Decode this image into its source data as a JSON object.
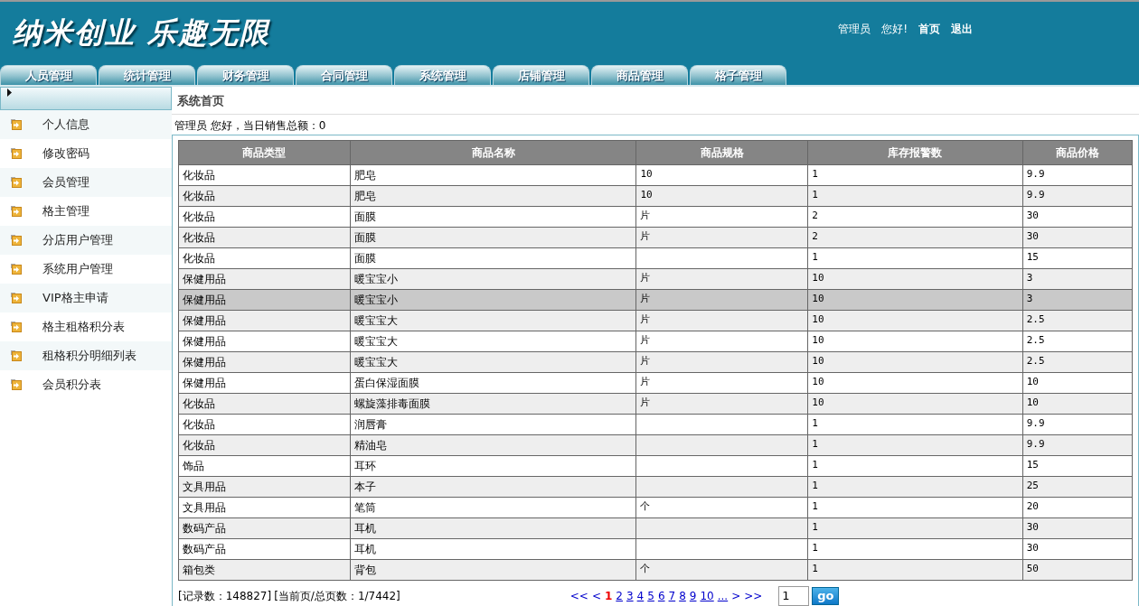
{
  "header": {
    "logo": "纳米创业 乐趣无限",
    "user": "管理员",
    "greeting": "您好!",
    "links": [
      "首页",
      "退出"
    ]
  },
  "tabs": [
    {
      "label": "人员管理",
      "selected": false
    },
    {
      "label": "统计管理",
      "selected": false
    },
    {
      "label": "财务管理",
      "selected": false
    },
    {
      "label": "合同管理",
      "selected": false
    },
    {
      "label": "系统管理",
      "selected": false
    },
    {
      "label": "店铺管理",
      "selected": false
    },
    {
      "label": "商品管理",
      "selected": false
    },
    {
      "label": "格子管理",
      "selected": false
    }
  ],
  "sidebar": {
    "items": [
      "个人信息",
      "修改密码",
      "会员管理",
      "格主管理",
      "分店用户管理",
      "系统用户管理",
      "VIP格主申请",
      "格主租格积分表",
      "租格积分明细列表",
      "会员积分表"
    ]
  },
  "page_title": "系统首页",
  "summary": "管理员 您好，当日销售总额：0",
  "table": {
    "columns": [
      "商品类型",
      "商品名称",
      "商品规格",
      "库存报警数",
      "商品价格"
    ],
    "rows": [
      {
        "cells": [
          "化妆品",
          "肥皂",
          "10",
          "1",
          "9.9"
        ],
        "selected": false
      },
      {
        "cells": [
          "化妆品",
          "肥皂",
          "10",
          "1",
          "9.9"
        ],
        "selected": false
      },
      {
        "cells": [
          "化妆品",
          "面膜",
          "片",
          "2",
          "30"
        ],
        "selected": false
      },
      {
        "cells": [
          "化妆品",
          "面膜",
          "片",
          "2",
          "30"
        ],
        "selected": false
      },
      {
        "cells": [
          "化妆品",
          "面膜",
          "",
          "1",
          "15"
        ],
        "selected": false
      },
      {
        "cells": [
          "保健用品",
          "暖宝宝小",
          "片",
          "10",
          "3"
        ],
        "selected": false
      },
      {
        "cells": [
          "保健用品",
          "暖宝宝小",
          "片",
          "10",
          "3"
        ],
        "selected": true
      },
      {
        "cells": [
          "保健用品",
          "暖宝宝大",
          "片",
          "10",
          "2.5"
        ],
        "selected": false
      },
      {
        "cells": [
          "保健用品",
          "暖宝宝大",
          "片",
          "10",
          "2.5"
        ],
        "selected": false
      },
      {
        "cells": [
          "保健用品",
          "暖宝宝大",
          "片",
          "10",
          "2.5"
        ],
        "selected": false
      },
      {
        "cells": [
          "保健用品",
          "蛋白保湿面膜",
          "片",
          "10",
          "10"
        ],
        "selected": false
      },
      {
        "cells": [
          "化妆品",
          "螺旋藻排毒面膜",
          "片",
          "10",
          "10"
        ],
        "selected": false
      },
      {
        "cells": [
          "化妆品",
          "润唇膏",
          "",
          "1",
          "9.9"
        ],
        "selected": false
      },
      {
        "cells": [
          "化妆品",
          "精油皂",
          "",
          "1",
          "9.9"
        ],
        "selected": false
      },
      {
        "cells": [
          "饰品",
          "耳环",
          "",
          "1",
          "15"
        ],
        "selected": false
      },
      {
        "cells": [
          "文具用品",
          "本子",
          "",
          "1",
          "25"
        ],
        "selected": false
      },
      {
        "cells": [
          "文具用品",
          "笔筒",
          "个",
          "1",
          "20"
        ],
        "selected": false
      },
      {
        "cells": [
          "数码产品",
          "耳机",
          "",
          "1",
          "30"
        ],
        "selected": false
      },
      {
        "cells": [
          "数码产品",
          "耳机",
          "",
          "1",
          "30"
        ],
        "selected": false
      },
      {
        "cells": [
          "箱包类",
          "背包",
          "个",
          "1",
          "50"
        ],
        "selected": false
      }
    ]
  },
  "footer": {
    "records": "[记录数：148827]",
    "pages": "[当前页/总页数：1/7442]",
    "pager": [
      {
        "label": "<<",
        "selected": false
      },
      {
        "label": "<",
        "selected": false
      },
      {
        "label": "1",
        "selected": true
      },
      {
        "label": "2",
        "selected": false
      },
      {
        "label": "3",
        "selected": false
      },
      {
        "label": "4",
        "selected": false
      },
      {
        "label": "5",
        "selected": false
      },
      {
        "label": "6",
        "selected": false
      },
      {
        "label": "7",
        "selected": false
      },
      {
        "label": "8",
        "selected": false
      },
      {
        "label": "9",
        "selected": false
      },
      {
        "label": "10",
        "selected": false
      },
      {
        "label": "...",
        "selected": false
      },
      {
        "label": ">",
        "selected": false
      },
      {
        "label": ">>",
        "selected": false
      }
    ],
    "page_input": "1",
    "go": "go"
  }
}
